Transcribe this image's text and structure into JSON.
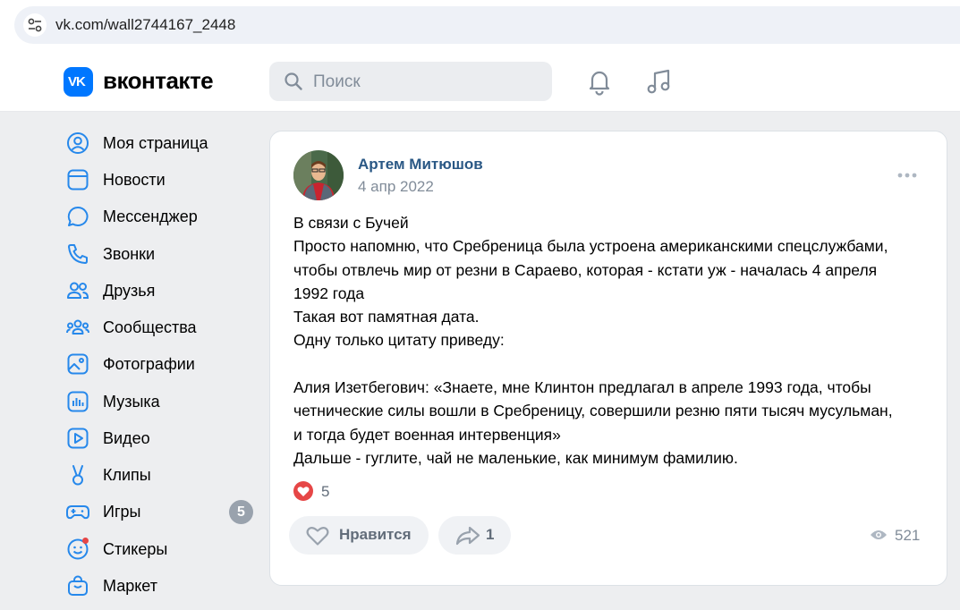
{
  "browser": {
    "url": "vk.com/wall2744167_2448"
  },
  "header": {
    "logo_text": "VK",
    "brand": "вконтакте",
    "search_placeholder": "Поиск",
    "accent_color": "#0077ff"
  },
  "sidebar": {
    "items": [
      {
        "label": "Моя страница",
        "icon": "user-circle-icon"
      },
      {
        "label": "Новости",
        "icon": "newsfeed-icon"
      },
      {
        "label": "Мессенджер",
        "icon": "message-bubble-icon"
      },
      {
        "label": "Звонки",
        "icon": "phone-icon"
      },
      {
        "label": "Друзья",
        "icon": "friends-icon"
      },
      {
        "label": "Сообщества",
        "icon": "communities-icon"
      },
      {
        "label": "Фотографии",
        "icon": "photo-icon"
      },
      {
        "label": "Музыка",
        "icon": "music-note-icon"
      },
      {
        "label": "Видео",
        "icon": "video-play-icon"
      },
      {
        "label": "Клипы",
        "icon": "clips-icon"
      },
      {
        "label": "Игры",
        "icon": "gamepad-icon",
        "badge": "5"
      },
      {
        "label": "Стикеры",
        "icon": "sticker-smile-icon"
      },
      {
        "label": "Маркет",
        "icon": "shopping-bag-icon"
      }
    ]
  },
  "post": {
    "author": "Артем Митюшов",
    "date": "4 апр 2022",
    "lines": [
      "В связи с Бучей",
      "Просто напомню, что Сребреница была устроена американскими спецслужбами,",
      "чтобы отвлечь мир от резни в Сараево, которая - кстати уж - началась 4 апреля",
      "1992 года",
      "Такая вот памятная дата.",
      "Одну только цитату приведу:",
      "",
      "Алия Изетбегович: «Знаете, мне Клинтон предлагал в апреле 1993 года, чтобы",
      "четнические силы вошли в Сребреницу, совершили резню пяти тысяч мусульман,",
      "и тогда будет военная интервенция»",
      "Дальше - гуглите, чай не маленькие, как минимум фамилию."
    ],
    "reactions_count": "5",
    "like_label": "Нравится",
    "share_count": "1",
    "views_count": "521",
    "author_color": "#2a5885"
  }
}
